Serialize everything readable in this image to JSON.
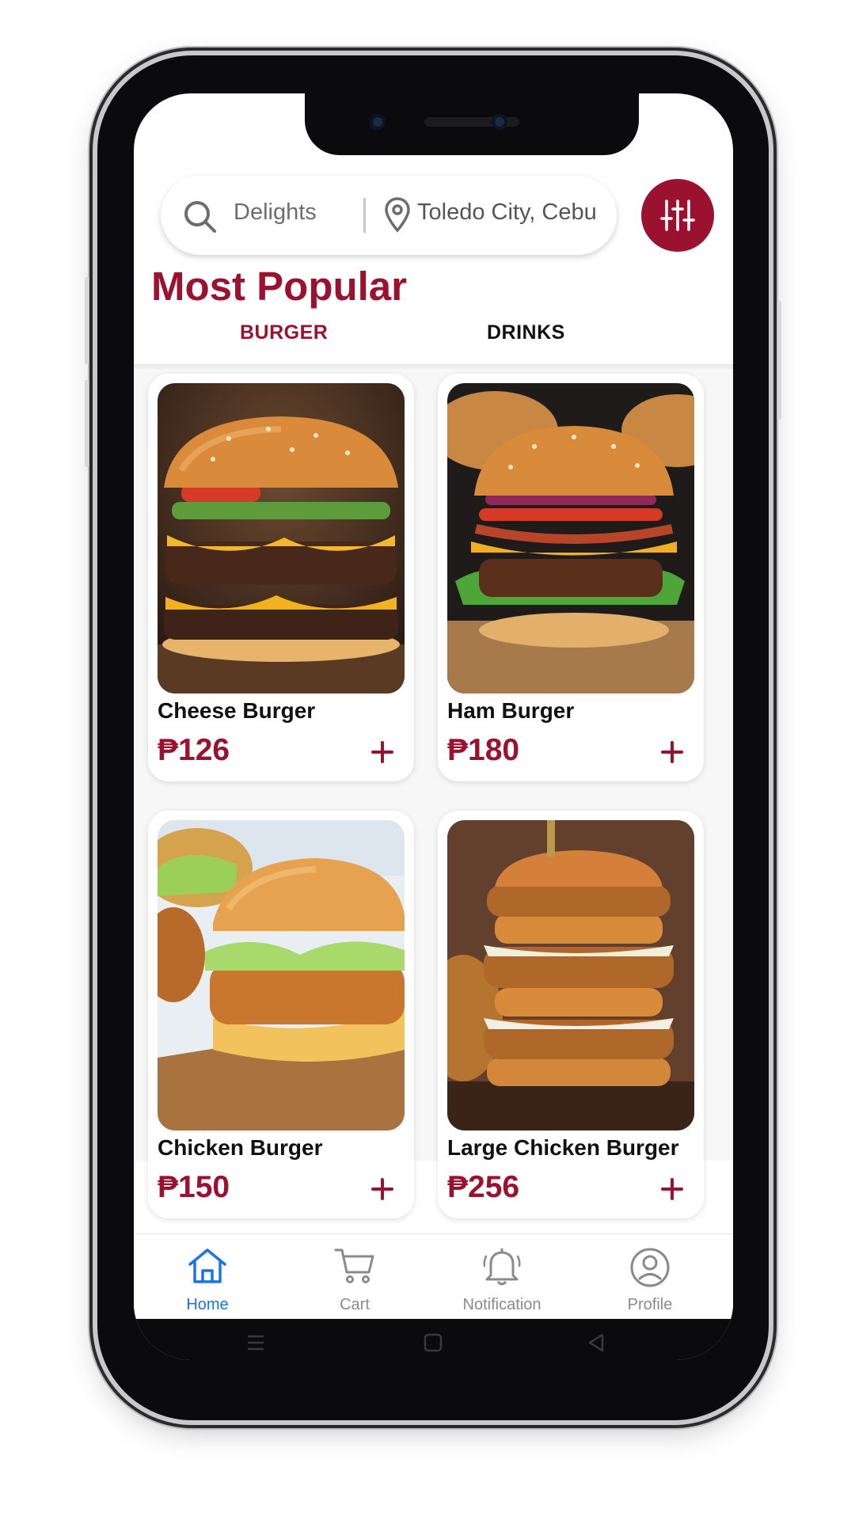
{
  "search": {
    "placeholder": "Delights"
  },
  "location": {
    "text": "Toledo City, Cebu"
  },
  "section": {
    "title": "Most Popular"
  },
  "tabs": [
    {
      "label": "BURGER",
      "active": true
    },
    {
      "label": "DRINKS",
      "active": false
    }
  ],
  "products": [
    {
      "name": "Cheese Burger",
      "price": "₱126"
    },
    {
      "name": "Ham Burger",
      "price": "₱180"
    },
    {
      "name": "Chicken Burger",
      "price": "₱150"
    },
    {
      "name": "Large Chicken Burger",
      "price": "₱256"
    }
  ],
  "bottom_nav": [
    {
      "label": "Home",
      "icon": "home-icon",
      "active": true
    },
    {
      "label": "Cart",
      "icon": "cart-icon",
      "active": false
    },
    {
      "label": "Notification",
      "icon": "bell-icon",
      "active": false
    },
    {
      "label": "Profile",
      "icon": "profile-icon",
      "active": false
    }
  ],
  "colors": {
    "accent": "#9b1230",
    "nav_active": "#1a73e8"
  }
}
